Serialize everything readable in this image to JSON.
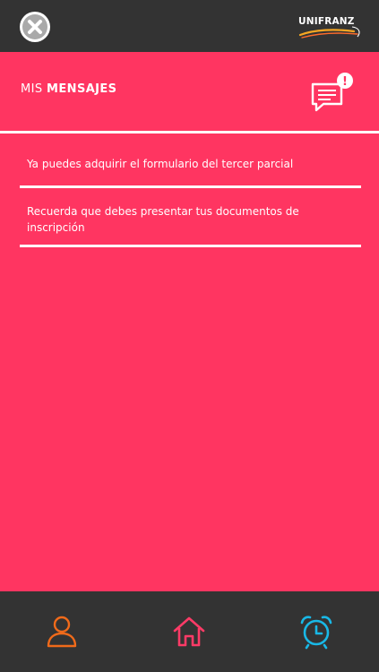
{
  "brand": {
    "logo_text": "UNIFRANZ"
  },
  "icons": {
    "close": "close-circle-icon",
    "messages": "message-alert-icon",
    "profile": "user-icon",
    "home": "home-icon",
    "alarm": "alarm-clock-icon"
  },
  "header": {
    "title_prefix": "MIS ",
    "title_bold": "MENSAJES",
    "alert_badge": "!"
  },
  "messages": [
    {
      "text": "Ya puedes adquirir el formulario del tercer parcial"
    },
    {
      "text": "Recuerda que debes presentar tus documentos de inscripción"
    }
  ],
  "colors": {
    "accent": "#ff3561",
    "bar": "#333333",
    "profile_icon": "#f06a1a",
    "home_icon": "#ff3b67",
    "alarm_icon": "#19b8e6"
  }
}
